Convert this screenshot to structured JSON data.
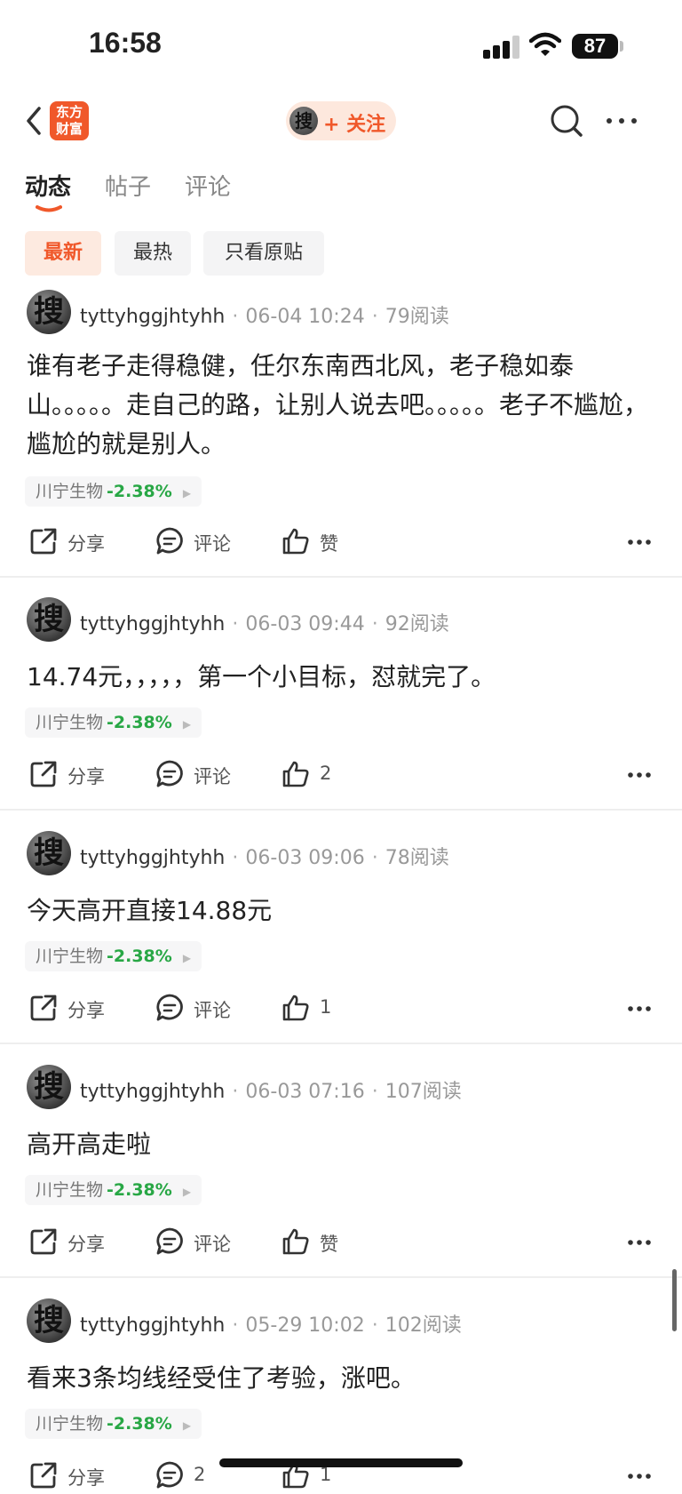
{
  "status_bar": {
    "time": "16:58",
    "battery": "87"
  },
  "header": {
    "logo_line1": "东方",
    "logo_line2": "财富",
    "avatar_char": "搜",
    "follow_label": "+ 关注"
  },
  "tabs": [
    {
      "label": "动态",
      "active": true
    },
    {
      "label": "帖子",
      "active": false
    },
    {
      "label": "评论",
      "active": false
    }
  ],
  "filters": [
    {
      "label": "最新",
      "active": true
    },
    {
      "label": "最热",
      "active": false
    },
    {
      "label": "只看原贴",
      "active": false
    }
  ],
  "labels": {
    "share": "分享",
    "comment": "评论"
  },
  "colors": {
    "accent": "#f0582a",
    "down_green": "#28a745"
  },
  "posts": [
    {
      "avatar_char": "搜",
      "username": "tyttyhggjhtyhh",
      "date": "06-04 10:24",
      "reads": "79阅读",
      "content": "谁有老子走得稳健，任尔东南西北风，老子稳如泰山。。。。。走自己的路，让别人说去吧。。。。。老子不尴尬，尴尬的就是别人。",
      "stock": "川宁生物",
      "change": "-2.38%",
      "likes": "赞"
    },
    {
      "avatar_char": "搜",
      "username": "tyttyhggjhtyhh",
      "date": "06-03 09:44",
      "reads": "92阅读",
      "content": "14.74元，，，，，第一个小目标，怼就完了。",
      "stock": "川宁生物",
      "change": "-2.38%",
      "likes": "2"
    },
    {
      "avatar_char": "搜",
      "username": "tyttyhggjhtyhh",
      "date": "06-03 09:06",
      "reads": "78阅读",
      "content": "今天高开直接14.88元",
      "stock": "川宁生物",
      "change": "-2.38%",
      "likes": "1"
    },
    {
      "avatar_char": "搜",
      "username": "tyttyhggjhtyhh",
      "date": "06-03 07:16",
      "reads": "107阅读",
      "content": "高开高走啦",
      "stock": "川宁生物",
      "change": "-2.38%",
      "likes": "赞"
    },
    {
      "avatar_char": "搜",
      "username": "tyttyhggjhtyhh",
      "date": "05-29 10:02",
      "reads": "102阅读",
      "content": "看来3条均线经受住了考验，涨吧。",
      "stock": "川宁生物",
      "change": "-2.38%",
      "comments": "2",
      "likes": "1"
    }
  ]
}
